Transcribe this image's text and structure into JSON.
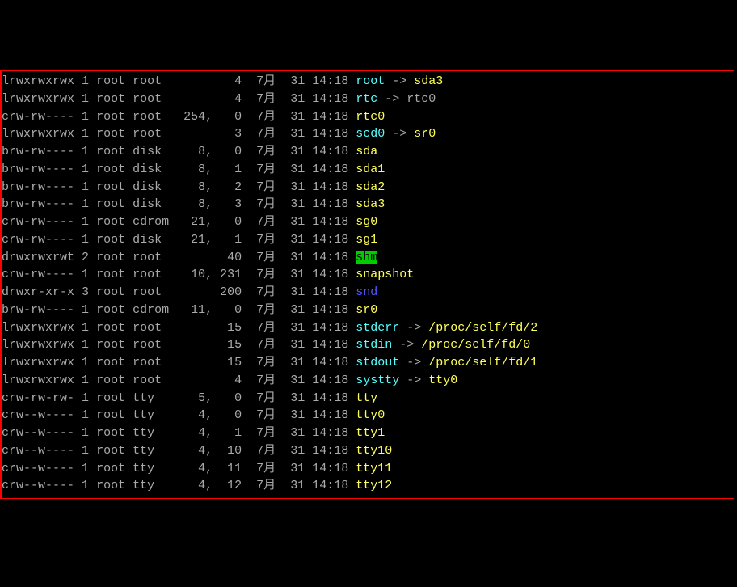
{
  "rows": [
    {
      "perms": "lrwxrwxrwx",
      "links": "1",
      "user": "root",
      "group": "root",
      "major": "",
      "minor": "",
      "size": "4",
      "month": "7月",
      "day": "31",
      "time": "14:18",
      "name": "root",
      "nameClass": "fname-link",
      "target": "sda3",
      "targetClass": "target-dev"
    },
    {
      "perms": "lrwxrwxrwx",
      "links": "1",
      "user": "root",
      "group": "root",
      "major": "",
      "minor": "",
      "size": "4",
      "month": "7月",
      "day": "31",
      "time": "14:18",
      "name": "rtc",
      "nameClass": "fname-link",
      "target": "rtc0",
      "targetClass": "target-plain"
    },
    {
      "perms": "crw-rw----",
      "links": "1",
      "user": "root",
      "group": "root",
      "major": "254,",
      "minor": "0",
      "size": "",
      "month": "7月",
      "day": "31",
      "time": "14:18",
      "name": "rtc0",
      "nameClass": "fname-char",
      "target": "",
      "targetClass": ""
    },
    {
      "perms": "lrwxrwxrwx",
      "links": "1",
      "user": "root",
      "group": "root",
      "major": "",
      "minor": "",
      "size": "3",
      "month": "7月",
      "day": "31",
      "time": "14:18",
      "name": "scd0",
      "nameClass": "fname-link",
      "target": "sr0",
      "targetClass": "target-dev"
    },
    {
      "perms": "brw-rw----",
      "links": "1",
      "user": "root",
      "group": "disk",
      "major": "8,",
      "minor": "0",
      "size": "",
      "month": "7月",
      "day": "31",
      "time": "14:18",
      "name": "sda",
      "nameClass": "fname-block",
      "target": "",
      "targetClass": ""
    },
    {
      "perms": "brw-rw----",
      "links": "1",
      "user": "root",
      "group": "disk",
      "major": "8,",
      "minor": "1",
      "size": "",
      "month": "7月",
      "day": "31",
      "time": "14:18",
      "name": "sda1",
      "nameClass": "fname-block",
      "target": "",
      "targetClass": ""
    },
    {
      "perms": "brw-rw----",
      "links": "1",
      "user": "root",
      "group": "disk",
      "major": "8,",
      "minor": "2",
      "size": "",
      "month": "7月",
      "day": "31",
      "time": "14:18",
      "name": "sda2",
      "nameClass": "fname-block",
      "target": "",
      "targetClass": ""
    },
    {
      "perms": "brw-rw----",
      "links": "1",
      "user": "root",
      "group": "disk",
      "major": "8,",
      "minor": "3",
      "size": "",
      "month": "7月",
      "day": "31",
      "time": "14:18",
      "name": "sda3",
      "nameClass": "fname-block",
      "target": "",
      "targetClass": ""
    },
    {
      "perms": "crw-rw----",
      "links": "1",
      "user": "root",
      "group": "cdrom",
      "major": "21,",
      "minor": "0",
      "size": "",
      "month": "7月",
      "day": "31",
      "time": "14:18",
      "name": "sg0",
      "nameClass": "fname-char",
      "target": "",
      "targetClass": ""
    },
    {
      "perms": "crw-rw----",
      "links": "1",
      "user": "root",
      "group": "disk",
      "major": "21,",
      "minor": "1",
      "size": "",
      "month": "7月",
      "day": "31",
      "time": "14:18",
      "name": "sg1",
      "nameClass": "fname-char",
      "target": "",
      "targetClass": ""
    },
    {
      "perms": "drwxrwxrwt",
      "links": "2",
      "user": "root",
      "group": "root",
      "major": "",
      "minor": "",
      "size": "40",
      "month": "7月",
      "day": "31",
      "time": "14:18",
      "name": "shm",
      "nameClass": "fname-sticky",
      "target": "",
      "targetClass": ""
    },
    {
      "perms": "crw-rw----",
      "links": "1",
      "user": "root",
      "group": "root",
      "major": "10,",
      "minor": "231",
      "size": "",
      "month": "7月",
      "day": "31",
      "time": "14:18",
      "name": "snapshot",
      "nameClass": "fname-char",
      "target": "",
      "targetClass": ""
    },
    {
      "perms": "drwxr-xr-x",
      "links": "3",
      "user": "root",
      "group": "root",
      "major": "",
      "minor": "",
      "size": "200",
      "month": "7月",
      "day": "31",
      "time": "14:18",
      "name": "snd",
      "nameClass": "fname-dir",
      "target": "",
      "targetClass": ""
    },
    {
      "perms": "brw-rw----",
      "links": "1",
      "user": "root",
      "group": "cdrom",
      "major": "11,",
      "minor": "0",
      "size": "",
      "month": "7月",
      "day": "31",
      "time": "14:18",
      "name": "sr0",
      "nameClass": "fname-block",
      "target": "",
      "targetClass": ""
    },
    {
      "perms": "lrwxrwxrwx",
      "links": "1",
      "user": "root",
      "group": "root",
      "major": "",
      "minor": "",
      "size": "15",
      "month": "7月",
      "day": "31",
      "time": "14:18",
      "name": "stderr",
      "nameClass": "fname-link",
      "target": "/proc/self/fd/2",
      "targetClass": "target-dev"
    },
    {
      "perms": "lrwxrwxrwx",
      "links": "1",
      "user": "root",
      "group": "root",
      "major": "",
      "minor": "",
      "size": "15",
      "month": "7月",
      "day": "31",
      "time": "14:18",
      "name": "stdin",
      "nameClass": "fname-link",
      "target": "/proc/self/fd/0",
      "targetClass": "target-dev"
    },
    {
      "perms": "lrwxrwxrwx",
      "links": "1",
      "user": "root",
      "group": "root",
      "major": "",
      "minor": "",
      "size": "15",
      "month": "7月",
      "day": "31",
      "time": "14:18",
      "name": "stdout",
      "nameClass": "fname-link",
      "target": "/proc/self/fd/1",
      "targetClass": "target-dev"
    },
    {
      "perms": "lrwxrwxrwx",
      "links": "1",
      "user": "root",
      "group": "root",
      "major": "",
      "minor": "",
      "size": "4",
      "month": "7月",
      "day": "31",
      "time": "14:18",
      "name": "systty",
      "nameClass": "fname-link",
      "target": "tty0",
      "targetClass": "target-dev"
    },
    {
      "perms": "crw-rw-rw-",
      "links": "1",
      "user": "root",
      "group": "tty",
      "major": "5,",
      "minor": "0",
      "size": "",
      "month": "7月",
      "day": "31",
      "time": "14:18",
      "name": "tty",
      "nameClass": "fname-char",
      "target": "",
      "targetClass": ""
    },
    {
      "perms": "crw--w----",
      "links": "1",
      "user": "root",
      "group": "tty",
      "major": "4,",
      "minor": "0",
      "size": "",
      "month": "7月",
      "day": "31",
      "time": "14:18",
      "name": "tty0",
      "nameClass": "fname-char",
      "target": "",
      "targetClass": ""
    },
    {
      "perms": "crw--w----",
      "links": "1",
      "user": "root",
      "group": "tty",
      "major": "4,",
      "minor": "1",
      "size": "",
      "month": "7月",
      "day": "31",
      "time": "14:18",
      "name": "tty1",
      "nameClass": "fname-char",
      "target": "",
      "targetClass": ""
    },
    {
      "perms": "crw--w----",
      "links": "1",
      "user": "root",
      "group": "tty",
      "major": "4,",
      "minor": "10",
      "size": "",
      "month": "7月",
      "day": "31",
      "time": "14:18",
      "name": "tty10",
      "nameClass": "fname-char",
      "target": "",
      "targetClass": ""
    },
    {
      "perms": "crw--w----",
      "links": "1",
      "user": "root",
      "group": "tty",
      "major": "4,",
      "minor": "11",
      "size": "",
      "month": "7月",
      "day": "31",
      "time": "14:18",
      "name": "tty11",
      "nameClass": "fname-char",
      "target": "",
      "targetClass": ""
    },
    {
      "perms": "crw--w----",
      "links": "1",
      "user": "root",
      "group": "tty",
      "major": "4,",
      "minor": "12",
      "size": "",
      "month": "7月",
      "day": "31",
      "time": "14:18",
      "name": "tty12",
      "nameClass": "fname-char",
      "target": "",
      "targetClass": ""
    }
  ]
}
